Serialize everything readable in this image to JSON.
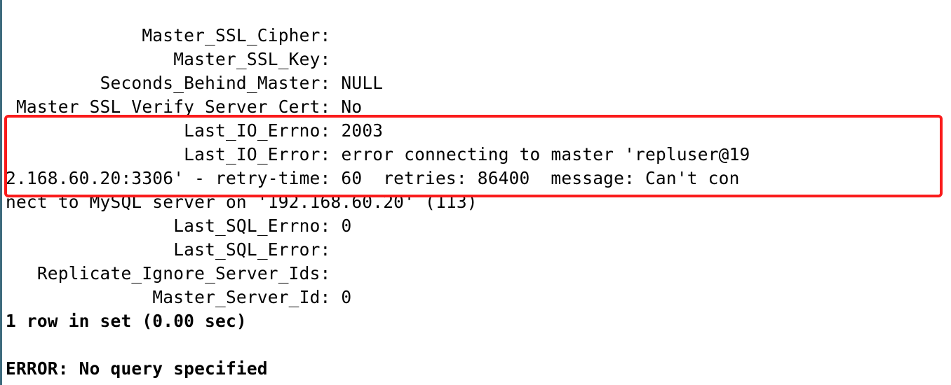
{
  "fields": {
    "master_ssl_cipher": {
      "label": "Master_SSL_Cipher:",
      "value": ""
    },
    "master_ssl_key": {
      "label": "Master_SSL_Key:",
      "value": ""
    },
    "seconds_behind_master": {
      "label": "Seconds_Behind_Master:",
      "value": "NULL"
    },
    "master_ssl_verify_server_cert": {
      "label": "Master_SSL_Verify_Server_Cert:",
      "value": "No"
    },
    "last_io_errno": {
      "label": "Last_IO_Errno:",
      "value": "2003"
    },
    "last_io_error": {
      "label": "Last_IO_Error:",
      "line1": "error connecting to master 'repluser@19",
      "line2": "2.168.60.20:3306' - retry-time: 60  retries: 86400  message: Can't con",
      "line3": "nect to MySQL server on '192.168.60.20' (113)"
    },
    "last_sql_errno": {
      "label": "Last_SQL_Errno:",
      "value": "0"
    },
    "last_sql_error": {
      "label": "Last_SQL_Error:",
      "value": ""
    },
    "replicate_ignore_server_ids": {
      "label": "Replicate_Ignore_Server_Ids:",
      "value": ""
    },
    "master_server_id": {
      "label": "Master_Server_Id:",
      "value": "0"
    }
  },
  "footer": {
    "rowset": "1 row in set (0.00 sec)",
    "error": "ERROR: No query specified"
  },
  "pad": {
    "master_ssl_cipher": "            ",
    "master_ssl_key": "               ",
    "seconds_behind_master": "        ",
    "master_ssl_verify_server_cert": "",
    "last_io_errno": "                ",
    "last_io_error": "                ",
    "last_sql_errno": "               ",
    "last_sql_error": "               ",
    "replicate_ignore_server_ids": "  ",
    "master_server_id": "             "
  }
}
